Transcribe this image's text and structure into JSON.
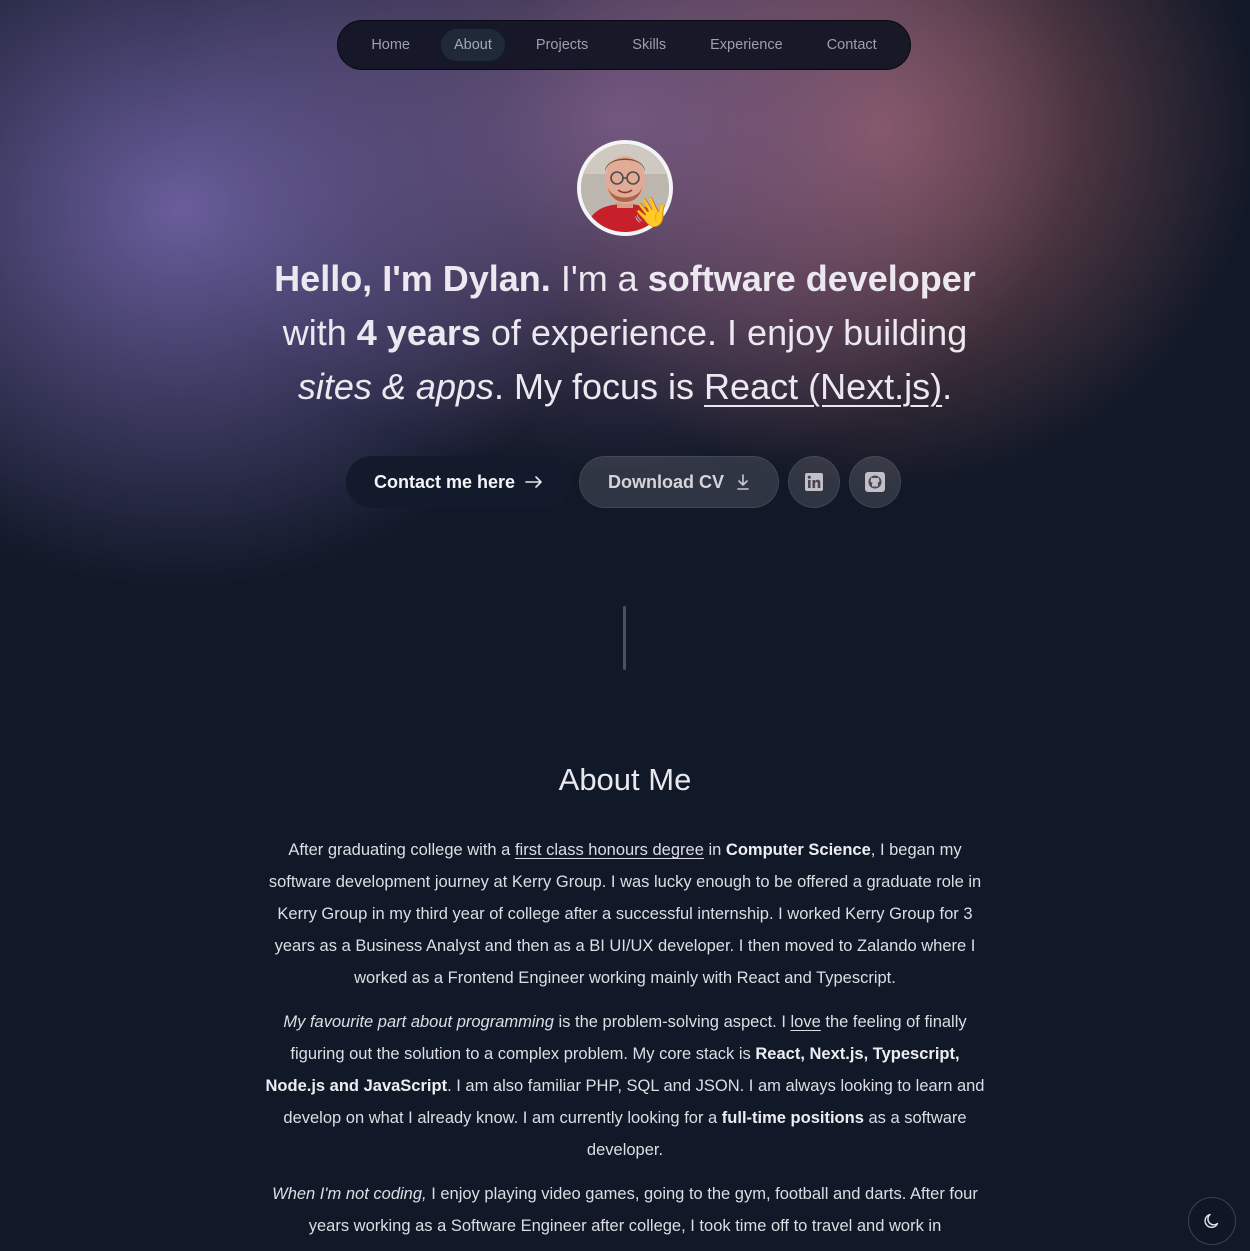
{
  "nav": {
    "items": [
      {
        "label": "Home"
      },
      {
        "label": "About"
      },
      {
        "label": "Projects"
      },
      {
        "label": "Skills"
      },
      {
        "label": "Experience"
      },
      {
        "label": "Contact"
      }
    ],
    "active": "About"
  },
  "hero": {
    "wave_emoji": "👋",
    "headline": {
      "t1": "Hello, I'm Dylan.",
      "t2": " I'm a ",
      "t3": "software developer",
      "t4": "with ",
      "t5": "4 years",
      "t6": " of experience. I enjoy building",
      "t7": "sites & apps",
      "t8": ". My focus is ",
      "t9": "React (Next.js)",
      "t10": "."
    },
    "buttons": {
      "contact_label": "Contact me here",
      "contact_icon": "arrow-right-icon",
      "cv_label": "Download CV",
      "cv_icon": "download-icon",
      "linkedin_icon": "linkedin-icon",
      "github_icon": "github-icon"
    }
  },
  "about": {
    "title": "About Me",
    "p1": {
      "a": "After graduating college with a ",
      "b": "first class honours degree",
      "c": " in ",
      "d": "Computer Science",
      "e": ", I began my software development journey at Kerry Group. I was lucky enough to be offered a graduate role in Kerry Group in my third year of college after a successful internship. I worked Kerry Group for 3 years as a Business Analyst and then as a BI UI/UX developer. I then moved to Zalando where I worked as a Frontend Engineer working mainly with React and Typescript."
    },
    "p2": {
      "a": "My favourite part about programming",
      "b": " is the problem-solving aspect. I ",
      "c": "love",
      "d": " the feeling of finally figuring out the solution to a complex problem. My core stack is ",
      "e": "React, Next.js, Typescript, Node.js and JavaScript",
      "f": ". I am also familiar PHP, SQL and JSON. I am always looking to learn and develop on what I already know. I am currently looking for a ",
      "g": "full-time positions",
      "h": " as a software developer."
    },
    "p3": {
      "a": "When I'm not coding,",
      "b": " I enjoy playing video games, going to the gym, football and darts. After four years working as a Software Engineer after college, I took time off to travel and work in"
    }
  },
  "theme_toggle": {
    "icon": "moon-icon"
  },
  "colors": {
    "background": "#111827",
    "nav_bg": "#11142a",
    "contact_button": "#121a2b",
    "text": "#e5e7eb"
  }
}
